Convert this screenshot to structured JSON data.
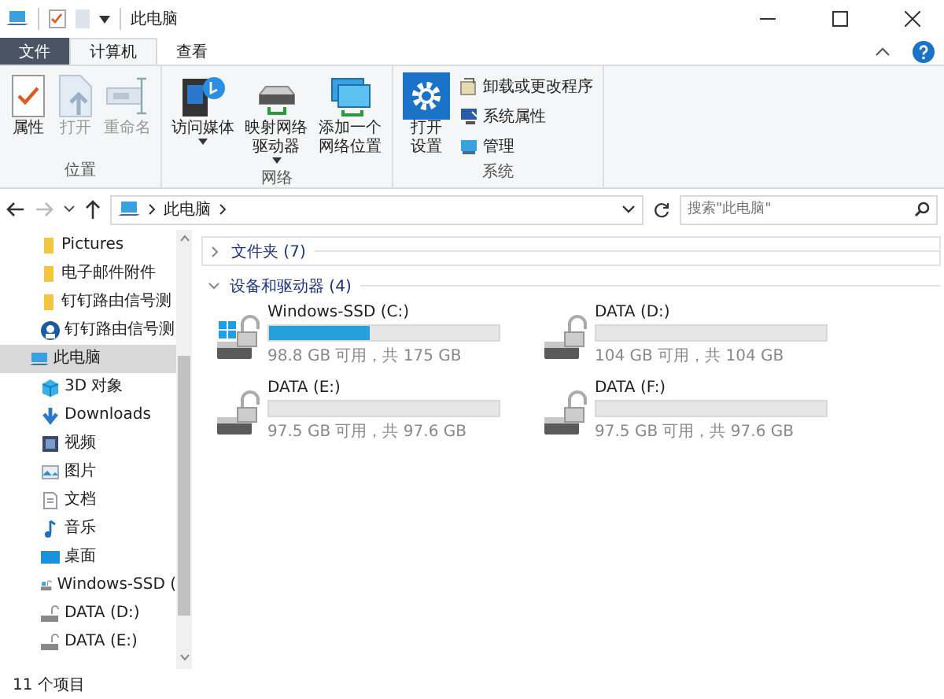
{
  "window": {
    "title": "此电脑"
  },
  "tabs": [
    {
      "label": "文件",
      "kind": "file",
      "selected": false
    },
    {
      "label": "计算机",
      "kind": "tab",
      "selected": true
    },
    {
      "label": "查看",
      "kind": "tab",
      "selected": false
    }
  ],
  "ribbon": [
    {
      "label": "位置",
      "buttons": [
        {
          "label": "属性",
          "disabled": false,
          "dropdown": false
        },
        {
          "label": "打开",
          "disabled": true,
          "dropdown": false
        },
        {
          "label": "重命名",
          "disabled": true,
          "dropdown": false
        }
      ]
    },
    {
      "label": "网络",
      "buttons": [
        {
          "label": "访问媒体",
          "disabled": false,
          "dropdown": true
        },
        {
          "label": "映射网络驱动器",
          "disabled": false,
          "dropdown": true
        },
        {
          "label": "添加一个网络位置",
          "disabled": false,
          "dropdown": false
        }
      ]
    },
    {
      "label": "系统",
      "buttons": [
        {
          "label": "打开设置",
          "disabled": false,
          "dropdown": false
        }
      ],
      "small_buttons": [
        {
          "label": "卸载或更改程序"
        },
        {
          "label": "系统属性"
        },
        {
          "label": "管理"
        }
      ]
    }
  ],
  "address": {
    "path": "此电脑",
    "placeholder": "搜索\"此电脑\""
  },
  "sidebar": {
    "items": [
      {
        "label": "Pictures",
        "kind": "folder",
        "selected": false
      },
      {
        "label": "电子邮件附件",
        "kind": "folder",
        "selected": false
      },
      {
        "label": "钉钉路由信号测",
        "kind": "folder",
        "selected": false
      },
      {
        "label": "钉钉路由信号测",
        "kind": "app",
        "selected": false
      },
      {
        "label": "此电脑",
        "kind": "pc",
        "selected": true,
        "children": [
          {
            "label": "3D 对象",
            "kind": "cube",
            "selected": false
          },
          {
            "label": "Downloads",
            "kind": "download",
            "selected": false
          },
          {
            "label": "视频",
            "kind": "video",
            "selected": false
          },
          {
            "label": "图片",
            "kind": "picture",
            "selected": false
          },
          {
            "label": "文档",
            "kind": "document",
            "selected": false
          },
          {
            "label": "音乐",
            "kind": "music",
            "selected": false
          },
          {
            "label": "桌面",
            "kind": "desktop",
            "selected": false
          },
          {
            "label": "Windows-SSD (",
            "kind": "sysdrive",
            "selected": false
          },
          {
            "label": "DATA (D:)",
            "kind": "drive",
            "selected": false
          },
          {
            "label": "DATA (E:)",
            "kind": "drive",
            "selected": false
          }
        ]
      }
    ]
  },
  "groups": [
    {
      "label": "文件夹 (7)",
      "expanded": false
    },
    {
      "label": "设备和驱动器 (4)",
      "expanded": true
    }
  ],
  "drives": [
    {
      "name": "Windows-SSD (C:)",
      "kind": "system",
      "level": 0.44,
      "reading": "98.8 GB 可用，共 175 GB"
    },
    {
      "name": "DATA (D:)",
      "kind": "data",
      "level": 0,
      "reading": "104 GB 可用，共 104 GB"
    },
    {
      "name": "DATA (E:)",
      "kind": "data",
      "level": 0,
      "reading": "97.5 GB 可用，共 97.6 GB"
    },
    {
      "name": "DATA (F:)",
      "kind": "data",
      "level": 0,
      "reading": "97.5 GB 可用，共 97.6 GB"
    }
  ],
  "status_bar": {
    "text": "11 个项目"
  }
}
